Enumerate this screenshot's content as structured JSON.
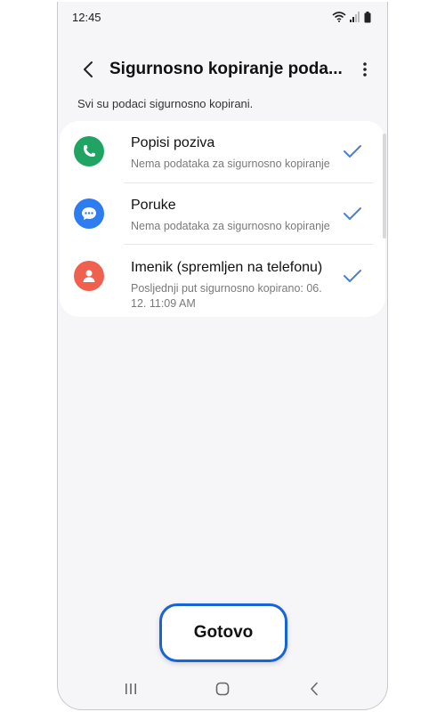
{
  "status": {
    "time": "12:45"
  },
  "header": {
    "title": "Sigurnosno kopiranje poda..."
  },
  "subtitle": "Svi su podaci sigurnosno kopirani.",
  "items": [
    {
      "name": "Popisi poziva",
      "desc": "Nema podataka za sigurnosno kopiranje",
      "icon": "phone-icon",
      "color": "#1fa463",
      "checked": true
    },
    {
      "name": "Poruke",
      "desc": "Nema podataka za sigurnosno kopiranje",
      "icon": "message-icon",
      "color": "#2d7cf0",
      "checked": true
    },
    {
      "name": "Imenik (spremljen na telefonu)",
      "desc": "Posljednji put sigurnosno kopirano: 06. 12. 11:09 AM",
      "icon": "contact-icon",
      "color": "#f0604f",
      "checked": true
    }
  ],
  "done_label": "Gotovo",
  "colors": {
    "accent": "#1763d8",
    "check": "#4a7fd1"
  }
}
